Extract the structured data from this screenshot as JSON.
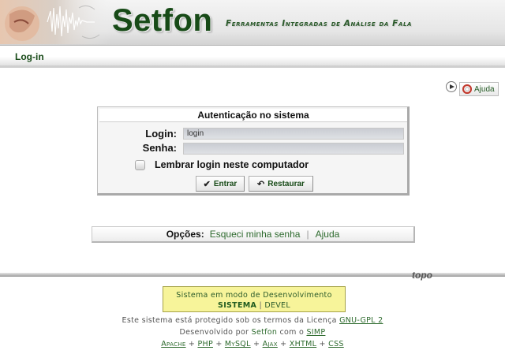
{
  "header": {
    "title": "Setfon",
    "subtitle": "Ferramentas Integradas de Análise da Fala"
  },
  "breadcrumb": {
    "current": "Log-in"
  },
  "help": {
    "label": "Ajuda"
  },
  "login": {
    "title": "Autenticação no sistema",
    "login_label": "Login:",
    "login_value": "login",
    "password_label": "Senha:",
    "password_value": "",
    "remember_label": "Lembrar login neste computador",
    "remember_checked": false,
    "submit_label": "Entrar",
    "reset_label": "Restaurar"
  },
  "options": {
    "label": "Opções:",
    "forgot_link": "Esqueci minha senha",
    "help_link": "Ajuda"
  },
  "topo": "topo",
  "dev": {
    "line1": "Sistema em modo de Desenvolvimento",
    "system": "SISTEMA",
    "separator": "|",
    "devel": "DEVEL"
  },
  "footer": {
    "license_text": "Este sistema está protegido sob os termos da Licença",
    "license_link": "GNU-GPL 2",
    "dev_by": "Desenvolvido por",
    "dev_org": "Setfon",
    "dev_with": "com o",
    "simp_link": "SIMP",
    "tech": [
      "Apache",
      "PHP",
      "MySQL",
      "Ajax",
      "XHTML",
      "CSS"
    ]
  },
  "colors": {
    "brand_green": "#174a17",
    "link_green": "#2d6a2d",
    "dev_yellow": "#f7f49a"
  }
}
